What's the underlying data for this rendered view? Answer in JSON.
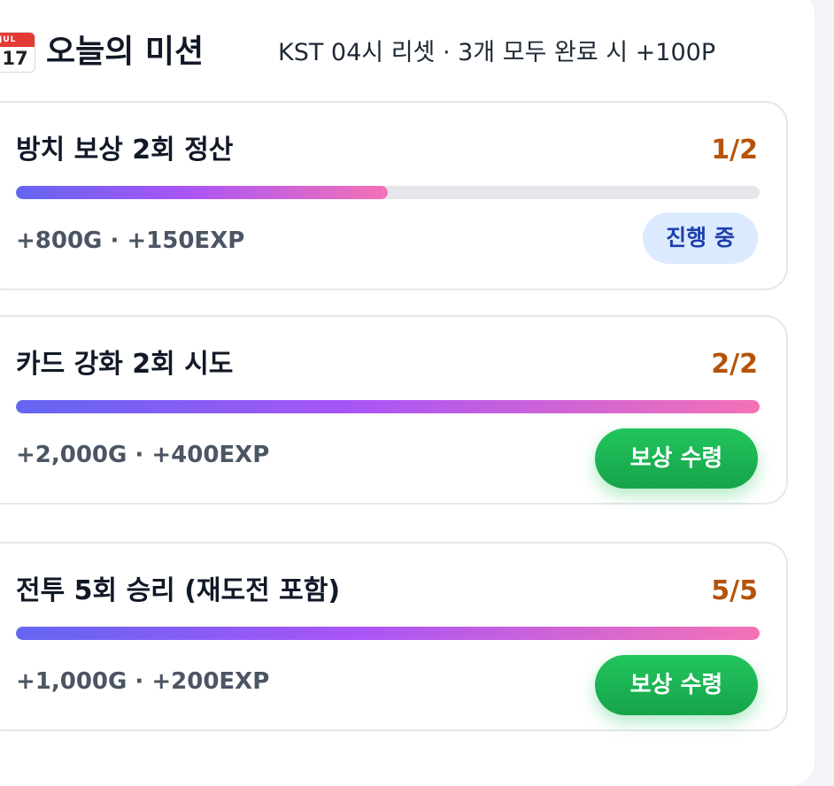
{
  "header": {
    "calendar_month": "JUL",
    "calendar_day": "17",
    "title": "오늘의 미션",
    "subtitle": "KST 04시 리셋 · 3개 모두 완료 시 +100P"
  },
  "missions": [
    {
      "name": "방치 보상 2회 정산",
      "progress": "1/2",
      "progress_fraction": 0.5,
      "reward": "+800G · +150EXP",
      "status": "진행 중"
    },
    {
      "name": "카드 강화 2회 시도",
      "progress": "2/2",
      "progress_fraction": 1.0,
      "reward": "+2,000G · +400EXP",
      "action": "보상 수령"
    },
    {
      "name": "전투 5회 승리 (재도전 포함)",
      "progress": "5/5",
      "progress_fraction": 1.0,
      "reward": "+1,000G · +200EXP",
      "action": "보상 수령"
    }
  ],
  "colors": {
    "progress_count": "#b45309",
    "claim_button": "#22c55e",
    "status_badge_bg": "#dbeafe",
    "status_badge_text": "#1e40af",
    "bar_gradient": [
      "#6366f1",
      "#a855f7",
      "#f472b6"
    ]
  }
}
